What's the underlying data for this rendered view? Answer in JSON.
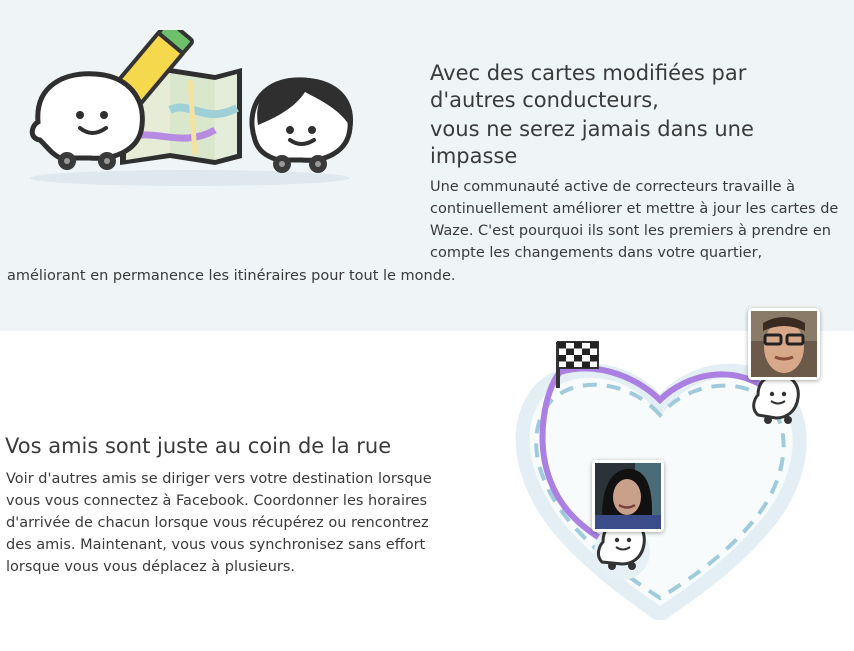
{
  "section_edit": {
    "title_line_1": "Avec des cartes modifiées par",
    "title_line_2": "d'autres conducteurs,",
    "title_line_3": "vous ne serez jamais dans une",
    "title_line_4": "impasse",
    "body": "Une communauté active de correcteurs travaille à continuellement améliorer et mettre à jour les cartes de Waze. C'est pourquoi ils sont les premiers à prendre en compte les changements dans votre quartier,",
    "body_tail": "améliorant en permanence les itinéraires pour tout le monde."
  },
  "section_friends": {
    "title": "Vos amis sont juste au coin de la rue",
    "body": "Voir d'autres amis se diriger vers votre destination lorsque vous vous connectez à Facebook. Coordonner les horaires d'arrivée de chacun lorsque vous récupérez ou rencontrez des amis. Maintenant, vous vous synchronisez sans effort lorsque vous vous déplacez à plusieurs."
  },
  "colors": {
    "band_background": "#eff4f7",
    "route_purple": "#a87fe0",
    "dash_blue": "#9fcbdc",
    "heart_outline": "#e6f1f5"
  },
  "icons": [
    "wazer-icon",
    "pencil-icon",
    "map-icon",
    "wazer-girl-icon",
    "checkered-flag-icon",
    "friend-avatar-man",
    "friend-avatar-woman"
  ]
}
